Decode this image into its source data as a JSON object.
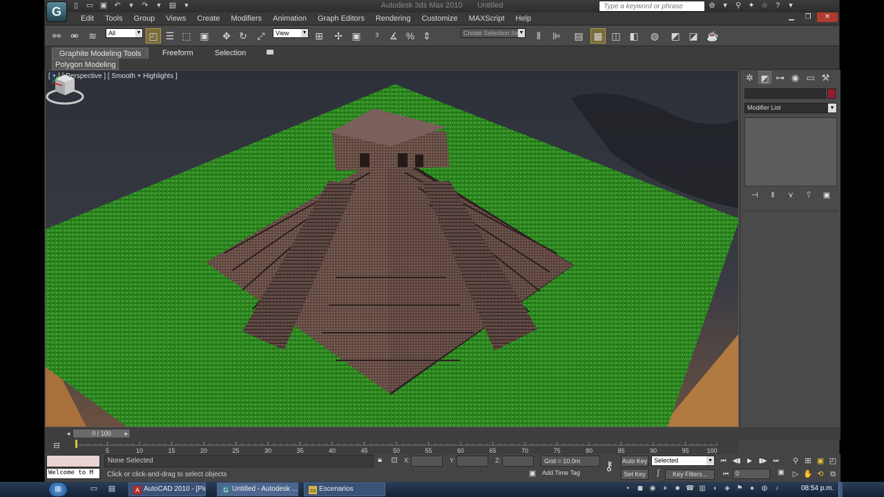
{
  "window": {
    "title": "Autodesk 3ds Max  2010",
    "document": "Untitled",
    "search_placeholder": "Type a keyword or phrase",
    "logo": "G"
  },
  "menu": [
    "Edit",
    "Tools",
    "Group",
    "Views",
    "Create",
    "Modifiers",
    "Animation",
    "Graph Editors",
    "Rendering",
    "Customize",
    "MAXScript",
    "Help"
  ],
  "toolbar": {
    "selection_filter": "All",
    "ref_coord": "View",
    "named_selection": "Create Selection Se"
  },
  "ribbon": {
    "tabs": [
      "Graphite Modeling Tools",
      "Freeform",
      "Selection"
    ],
    "panel": "Polygon Modeling"
  },
  "viewport": {
    "label": "[ + ] [ Perspective ] [ Smooth + Highlights ]"
  },
  "command_panel": {
    "modifier_list": "Modifier List",
    "object_color": "#9a1a2c"
  },
  "timeline": {
    "frame_display": "0 / 100",
    "ticks": [
      "5",
      "10",
      "15",
      "20",
      "25",
      "30",
      "35",
      "40",
      "45",
      "50",
      "55",
      "60",
      "65",
      "70",
      "75",
      "80",
      "85",
      "90",
      "95",
      "100"
    ]
  },
  "status": {
    "selection": "None Selected",
    "prompt": "Click or click-and-drag to select objects",
    "maxscript": "Welcome to M",
    "x_label": "X:",
    "y_label": "Y:",
    "z_label": "Z:",
    "grid": "Grid = 10.0m",
    "add_time_tag": "Add Time Tag",
    "auto_key": "Auto Key",
    "set_key": "Set Key",
    "key_mode": "Selected",
    "key_filters": "Key Filters...",
    "current_frame": "0"
  },
  "taskbar": {
    "tasks": [
      "AutoCAD 2010 - [Pir...",
      "Untitled - Autodesk ...",
      "Escenarios"
    ],
    "clock": "08:54 p.m."
  }
}
